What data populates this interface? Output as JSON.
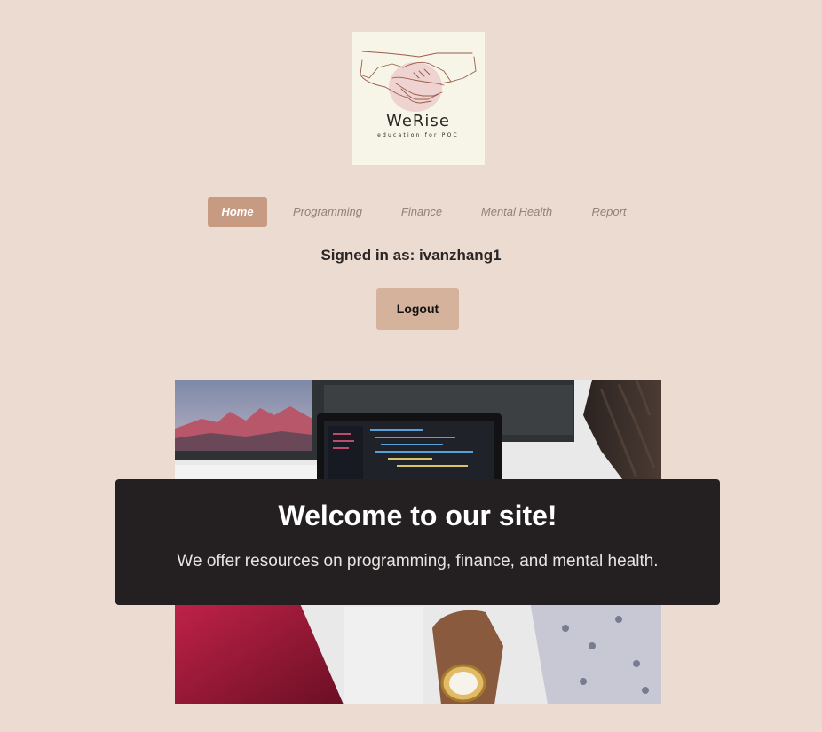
{
  "logo": {
    "title": "WeRise",
    "subtitle": "education for POC",
    "icon": "handshake-icon",
    "background": "#f6f5e8"
  },
  "nav": {
    "items": [
      {
        "label": "Home",
        "active": true
      },
      {
        "label": "Programming",
        "active": false
      },
      {
        "label": "Finance",
        "active": false
      },
      {
        "label": "Mental Health",
        "active": false
      },
      {
        "label": "Report",
        "active": false
      }
    ]
  },
  "user": {
    "signed_in_text": "Signed in as: ivanzhang1"
  },
  "actions": {
    "logout_label": "Logout"
  },
  "hero": {
    "title": "Welcome to our site!",
    "subtitle": "We offer resources on programming, finance, and mental health."
  },
  "colors": {
    "page_background": "#ecdbd1",
    "accent": "#c79a82",
    "button": "#d4b29c",
    "overlay": "#242021"
  }
}
